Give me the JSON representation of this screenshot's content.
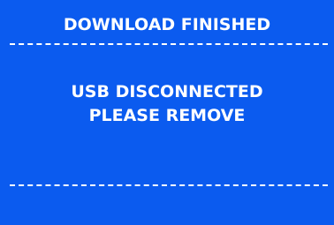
{
  "dialog": {
    "title": "DOWNLOAD FINISHED",
    "message_line_1": "USB DISCONNECTED",
    "message_line_2": "PLEASE REMOVE"
  },
  "colors": {
    "background": "#0b5bef",
    "text": "#ffffff"
  }
}
